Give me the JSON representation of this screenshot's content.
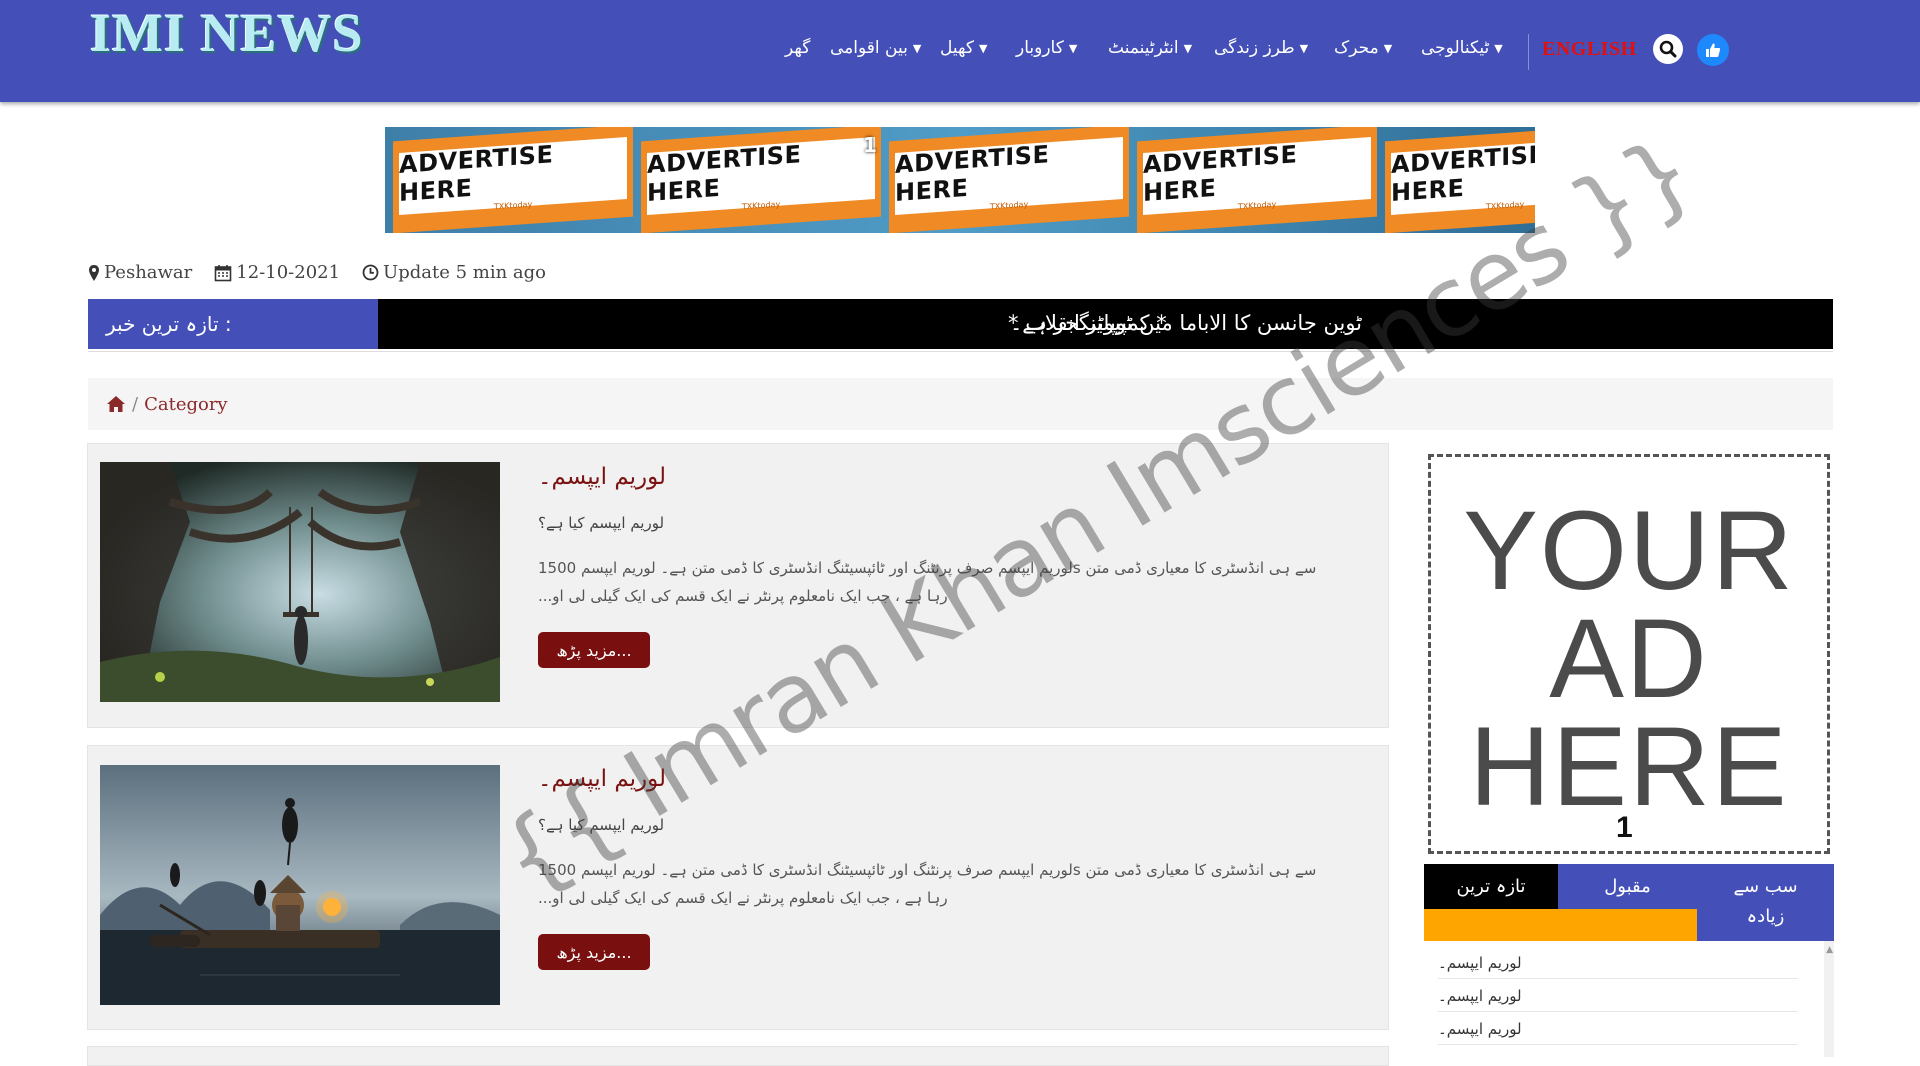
{
  "header": {
    "logo": "IMI NEWS",
    "nav": [
      {
        "label": "گھر",
        "has_dropdown": false
      },
      {
        "label": "بین اقوامی",
        "has_dropdown": true
      },
      {
        "label": "کھیل",
        "has_dropdown": true
      },
      {
        "label": "کاروبار",
        "has_dropdown": true
      },
      {
        "label": "انٹرٹینمنٹ",
        "has_dropdown": true
      },
      {
        "label": "طرز زندگی",
        "has_dropdown": true
      },
      {
        "label": "محرک",
        "has_dropdown": true
      },
      {
        "label": "ٹیکنالوجی",
        "has_dropdown": true
      }
    ],
    "language_link": "ENGLISH",
    "search_icon": "search-icon",
    "like_icon": "thumbs-up-icon",
    "colors": {
      "bar": "#4450b8",
      "language": "#e01010"
    }
  },
  "banner": {
    "ad_label": "ADVERTISE HERE",
    "ad_sub": "TXKtoday",
    "number": "1"
  },
  "meta": {
    "location": "Peshawar",
    "date": "12-10-2021",
    "update": "Update 5 min ago"
  },
  "ticker": {
    "label": "تازہ ترین خبر :",
    "items": [
      "ٹوین جانسن کا الاباما میں ٹوپلینگجر ہے۔",
      "* کمپیوٹر انقلاب *"
    ]
  },
  "breadcrumb": {
    "home_icon": "home-icon",
    "separator": "/",
    "current": "Category"
  },
  "articles": [
    {
      "title": "لوریم ایپسم۔",
      "question": "لوریم ایپسم کیا ہے؟",
      "body_line1": "سے ہی انڈسٹری کا معیاری ڈمی متن sلوریم ایپسم صرف پرنٹنگ اور ٹائپسیٹنگ انڈسٹری کا ڈمی متن ہے۔ لوریم ایپسم 1500",
      "body_line2": "رہا ہے ، جب ایک نامعلوم پرنٹر نے ایک قسم کی ایک گیلی لی او...",
      "button": "مزید پڑھ..."
    },
    {
      "title": "لوریم ایپسم۔",
      "question": "لوریم ایپسم کیا ہے؟",
      "body_line1": "سے ہی انڈسٹری کا معیاری ڈمی متن sلوریم ایپسم صرف پرنٹنگ اور ٹائپسیٹنگ انڈسٹری کا ڈمی متن ہے۔ لوریم ایپسم 1500",
      "body_line2": "رہا ہے ، جب ایک نامعلوم پرنٹر نے ایک قسم کی ایک گیلی لی او...",
      "button": "مزید پڑھ..."
    }
  ],
  "sidebar": {
    "ad_lines": [
      "YOUR",
      "AD",
      "HERE"
    ],
    "ad_number": "1",
    "tabs": {
      "latest": "تازہ ترین",
      "popular": "مقبول",
      "most": "سب سے زیادہ"
    },
    "list": [
      "لوریم ایپسم۔",
      "لوریم ایپسم۔",
      "لوریم ایپسم۔"
    ],
    "colors": {
      "active_tab": "#000000",
      "underline": "#ffa500"
    }
  },
  "watermark": "{{ Imran Khan Imsciences }}"
}
